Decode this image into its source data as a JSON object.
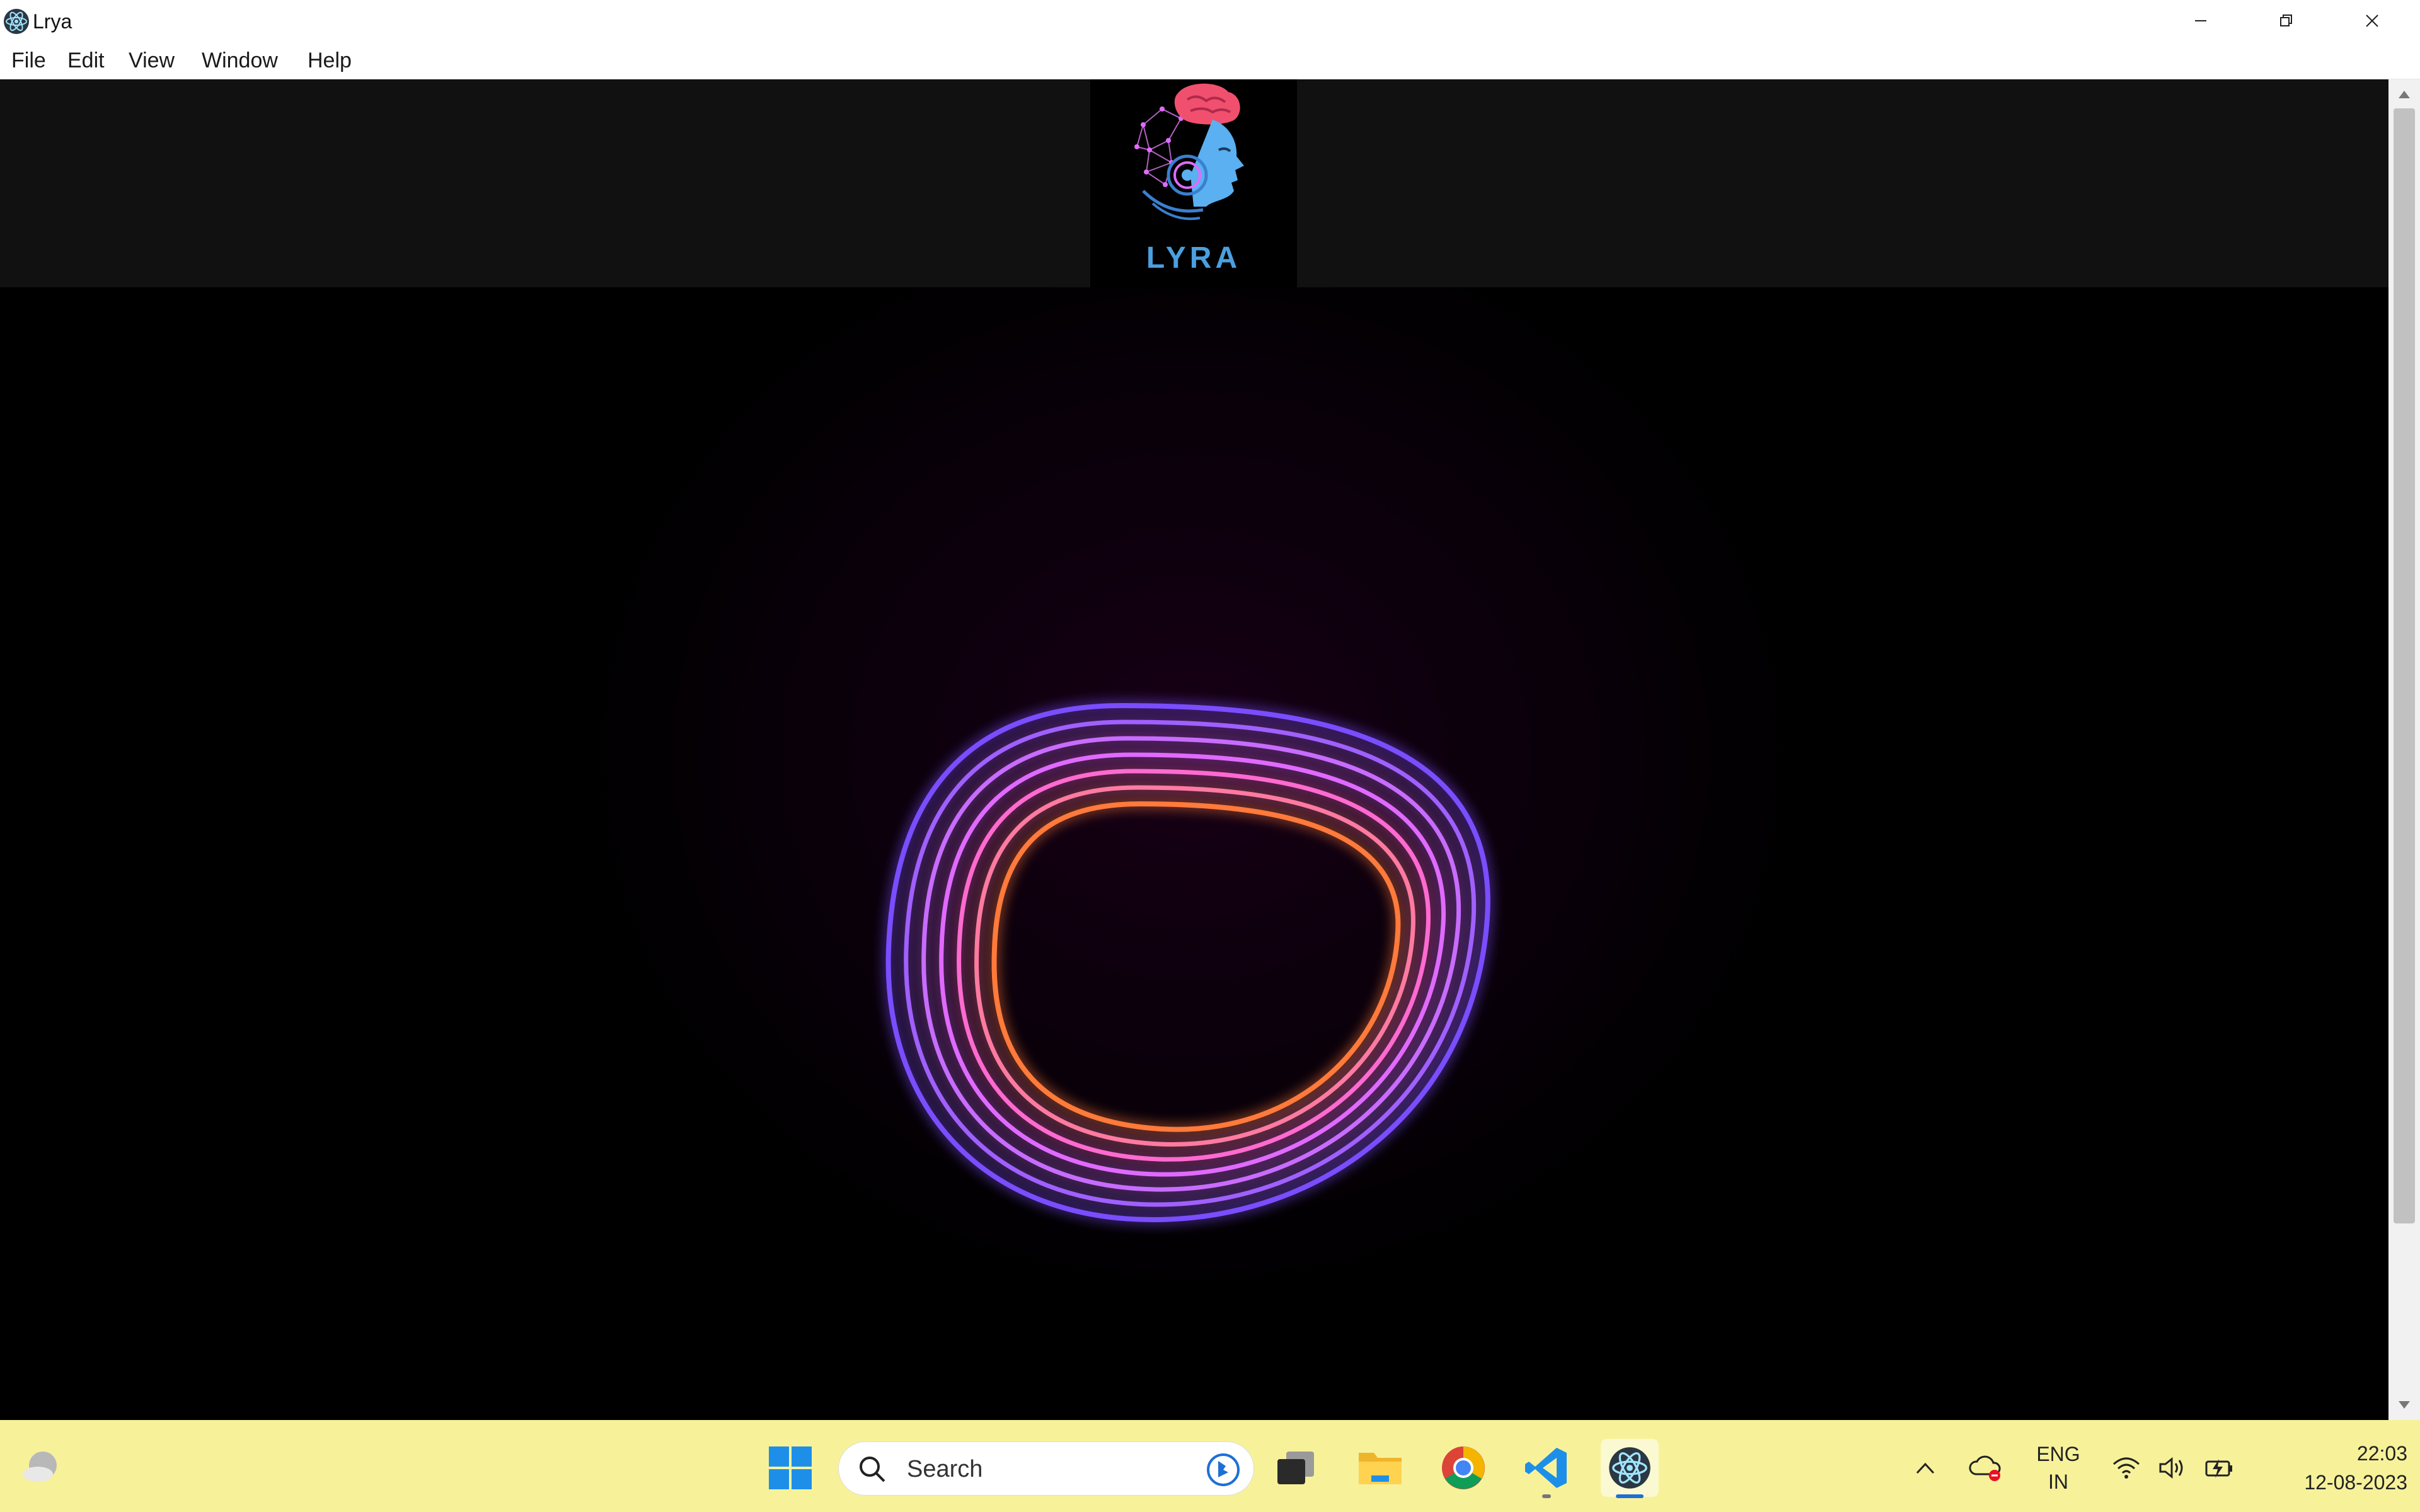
{
  "window": {
    "title": "Lrya",
    "controls": [
      "minimize",
      "restore",
      "close"
    ]
  },
  "menu": {
    "items": [
      "File",
      "Edit",
      "View",
      "Window",
      "Help"
    ]
  },
  "app": {
    "logo_text": "LYRA",
    "accent_color": "#4a9fe0",
    "orb_colors": [
      "#7a4dff",
      "#e06bff",
      "#ff7a3a"
    ]
  },
  "taskbar": {
    "search_placeholder": "Search",
    "pinned_apps": [
      "start-icon",
      "task-view-icon",
      "file-explorer-icon",
      "chrome-icon",
      "vscode-icon",
      "lyra-app-icon"
    ],
    "language_line1": "ENG",
    "language_line2": "IN",
    "time": "22:03",
    "date": "12-08-2023",
    "background_color": "#f7f29a"
  }
}
